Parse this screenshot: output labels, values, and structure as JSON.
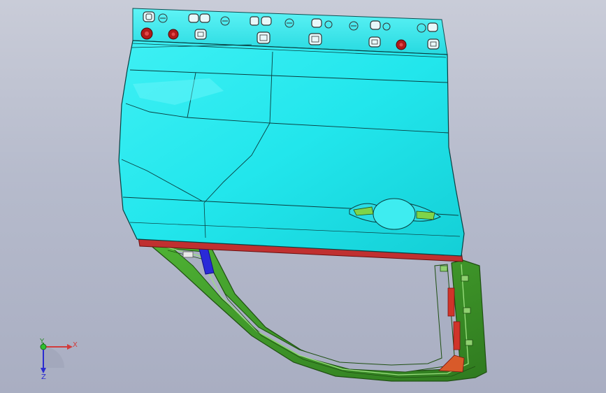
{
  "viewport": {
    "model": "car-door-assembly",
    "colors": {
      "background_top": "#c9ccd8",
      "background_bottom": "#a9aec2",
      "outer_panel": "#22e6ec",
      "outer_panel_shade": "#13cfd6",
      "inner_frame": "#3f9d2a",
      "inner_frame_dark": "#2c6f1b",
      "clip_red": "#b11a1a",
      "seal_red": "#c03030",
      "blue_part": "#2a2ad8"
    }
  },
  "triad": {
    "x_label": "X",
    "y_label": "Y",
    "z_label": "Z"
  }
}
